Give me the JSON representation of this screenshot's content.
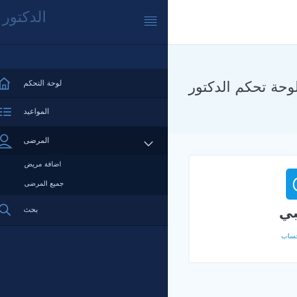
{
  "sidebar": {
    "title": "الدكتور",
    "items": [
      {
        "label": "لوحة التحكم",
        "icon": "home-icon"
      },
      {
        "label": "المواعيد",
        "icon": "list-icon"
      },
      {
        "label": "المرضى",
        "icon": "user-icon"
      },
      {
        "label": "بحث",
        "icon": "search-icon"
      }
    ],
    "patients_submenu": [
      {
        "label": "اضافة مريض"
      },
      {
        "label": "جميع المرضى"
      }
    ]
  },
  "main": {
    "page_title": "لوحة تحكم الدكتور",
    "card": {
      "title": "عبي",
      "link": "حساب"
    }
  },
  "colors": {
    "sidebar_bg": "#132649",
    "accent": "#1199e6",
    "page_bg": "#f4fafd"
  }
}
